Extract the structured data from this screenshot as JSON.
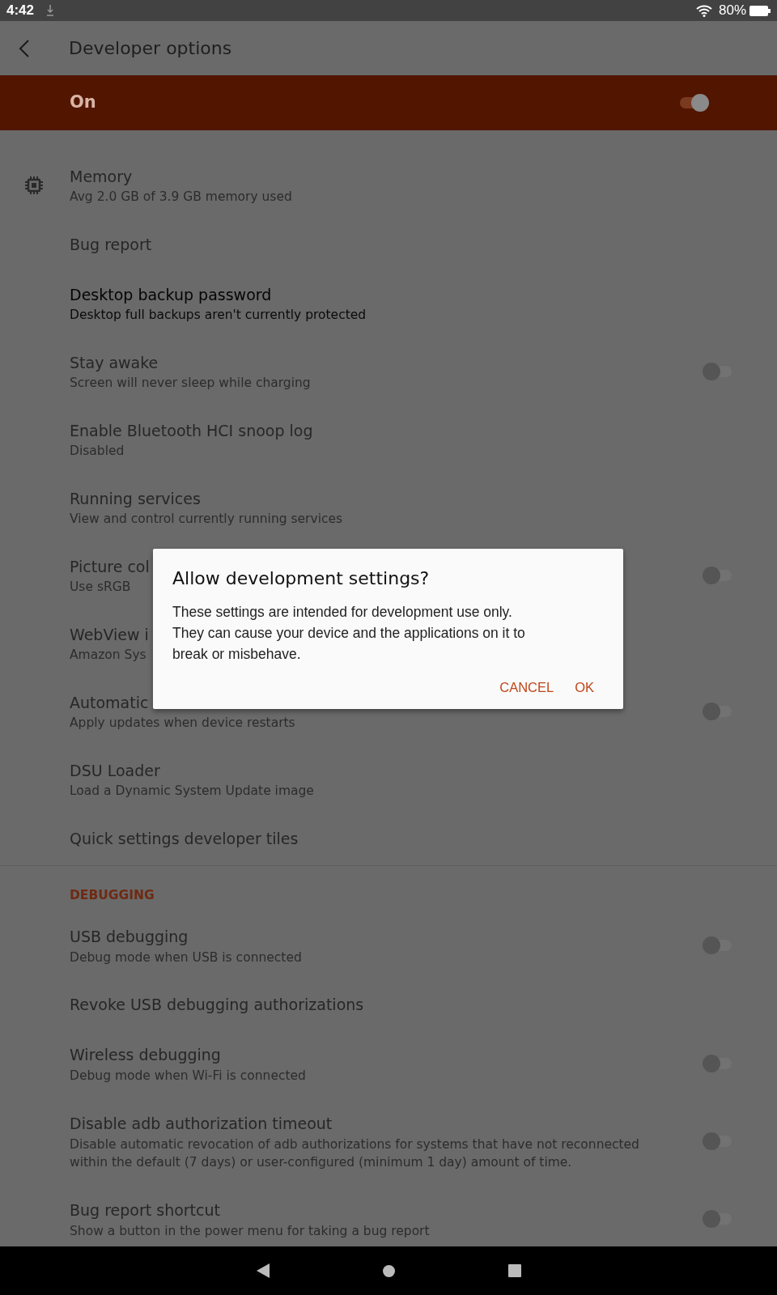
{
  "status_bar": {
    "time": "4:42",
    "battery": "80%"
  },
  "toolbar": {
    "title": "Developer options"
  },
  "master_switch": {
    "label": "On",
    "on": true
  },
  "rows": [
    {
      "kind": "icon",
      "title": "Memory",
      "subtitle": "Avg 2.0 GB of 3.9 GB memory used",
      "disabled": true
    },
    {
      "kind": "text",
      "title": "Bug report",
      "disabled": true
    },
    {
      "kind": "text",
      "title": "Desktop backup password",
      "subtitle": "Desktop full backups aren't currently protected",
      "disabled": false
    },
    {
      "kind": "switch",
      "title": "Stay awake",
      "subtitle": "Screen will never sleep while charging",
      "disabled": true,
      "on": false
    },
    {
      "kind": "text",
      "title": "Enable Bluetooth HCI snoop log",
      "subtitle": "Disabled",
      "disabled": true
    },
    {
      "kind": "text",
      "title": "Running services",
      "subtitle": "View and control currently running services",
      "disabled": true
    },
    {
      "kind": "switch",
      "title": "Picture col",
      "subtitle": "Use sRGB",
      "disabled": true,
      "on": false
    },
    {
      "kind": "text",
      "title": "WebView i",
      "subtitle": "Amazon Sys",
      "disabled": true
    },
    {
      "kind": "switch",
      "title": "Automatic",
      "subtitle": "Apply updates when device restarts",
      "disabled": true,
      "on": false
    },
    {
      "kind": "text",
      "title": "DSU Loader",
      "subtitle": "Load a Dynamic System Update image",
      "disabled": true
    },
    {
      "kind": "text",
      "title": "Quick settings developer tiles",
      "disabled": true
    },
    {
      "kind": "header",
      "title": "DEBUGGING"
    },
    {
      "kind": "switch",
      "title": "USB debugging",
      "subtitle": "Debug mode when USB is connected",
      "disabled": true,
      "on": false
    },
    {
      "kind": "text",
      "title": "Revoke USB debugging authorizations",
      "disabled": true
    },
    {
      "kind": "switch",
      "title": "Wireless debugging",
      "subtitle": "Debug mode when Wi-Fi is connected",
      "disabled": true,
      "on": false
    },
    {
      "kind": "switch",
      "title": "Disable adb authorization timeout",
      "subtitle": "Disable automatic revocation of adb authorizations for systems that have not reconnected within the default (7 days) or user-configured (minimum 1 day) amount of time.",
      "disabled": true,
      "on": false
    },
    {
      "kind": "switch",
      "title": "Bug report shortcut",
      "subtitle": "Show a button in the power menu for taking a bug report",
      "disabled": true,
      "on": false
    }
  ],
  "dialog": {
    "title": "Allow development settings?",
    "message": "These settings are intended for development use only. They can cause your device and the applications on it to break or misbehave.",
    "buttons": [
      "CANCEL",
      "OK"
    ]
  }
}
